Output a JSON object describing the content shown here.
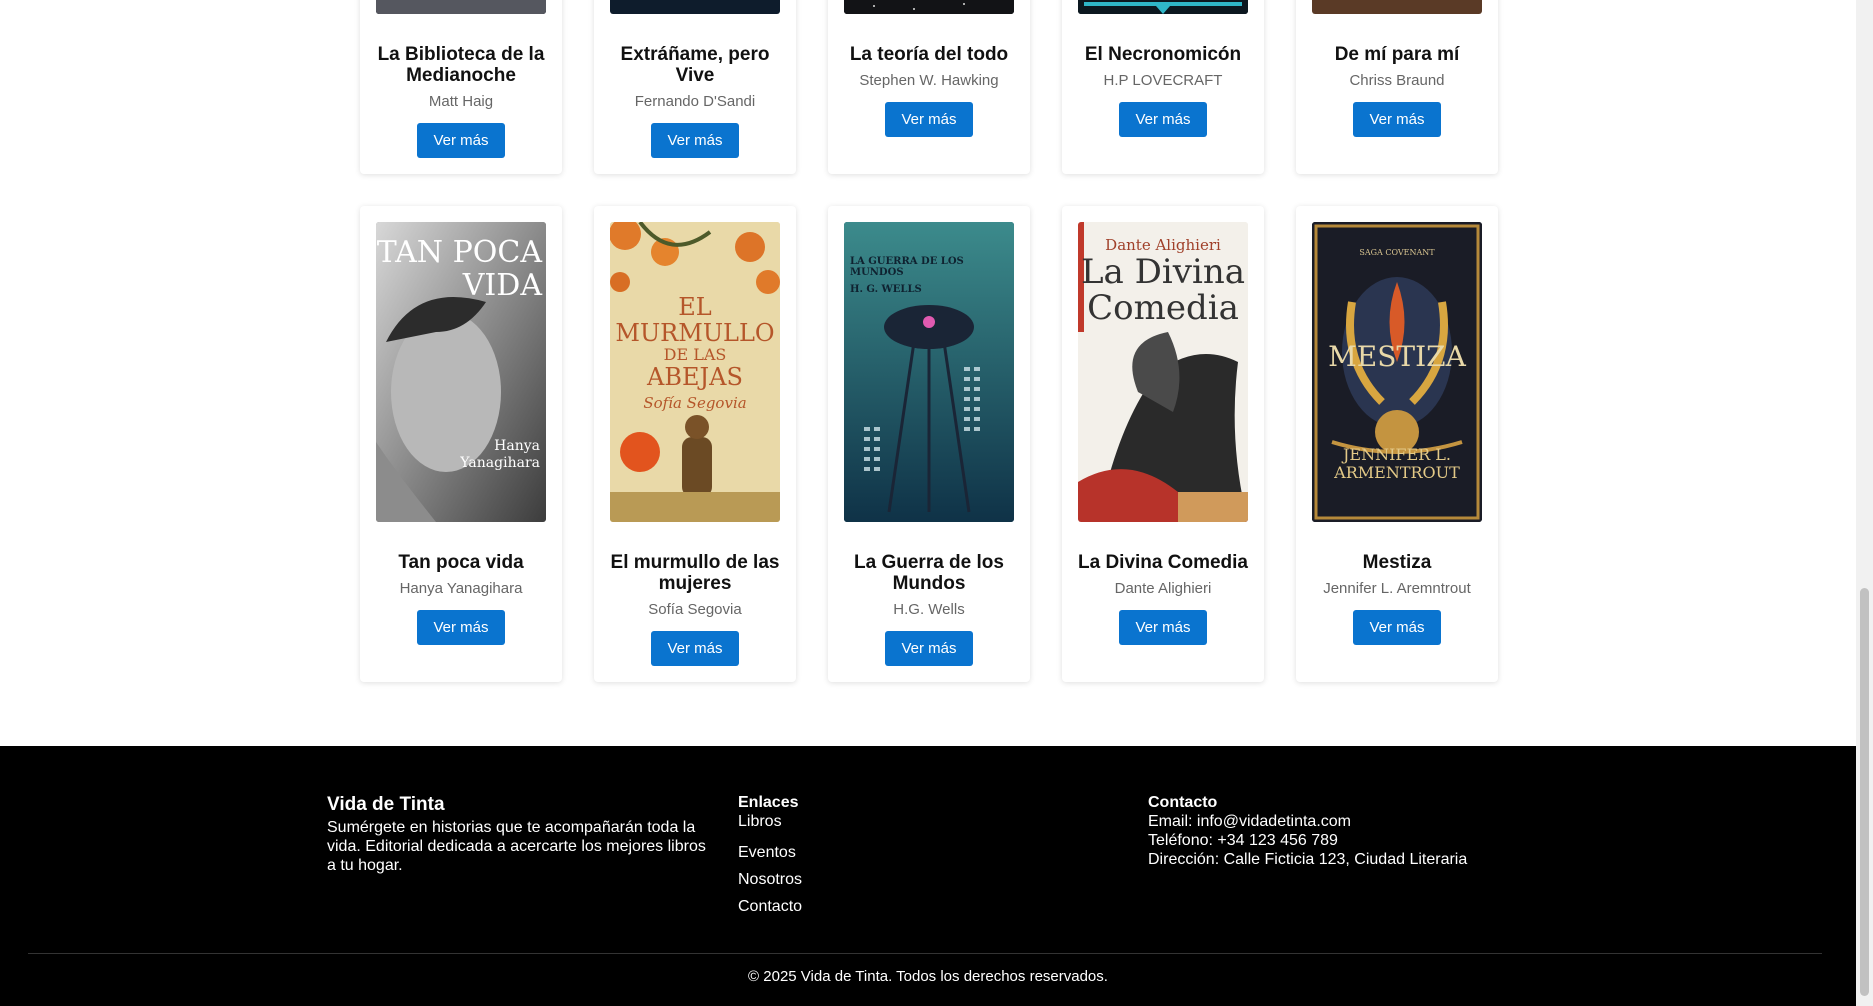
{
  "books_row1": [
    {
      "title": "La Biblioteca de la Medianoche",
      "author": "Matt Haig",
      "button": "Ver más"
    },
    {
      "title": "Extráñame, pero Vive",
      "author": "Fernando D'Sandi",
      "button": "Ver más"
    },
    {
      "title": "La teoría del todo",
      "author": "Stephen W. Hawking",
      "button": "Ver más"
    },
    {
      "title": "El Necronomicón",
      "author": "H.P LOVECRAFT",
      "button": "Ver más"
    },
    {
      "title": "De mí para mí",
      "author": "Chriss Braund",
      "button": "Ver más"
    }
  ],
  "books_row2": [
    {
      "title": "Tan poca vida",
      "author": "Hanya Yanagihara",
      "button": "Ver más",
      "cover_text": [
        "TAN POCA",
        "VIDA",
        "Hanya",
        "Yanagihara"
      ]
    },
    {
      "title": "El murmullo de las mujeres",
      "author": "Sofía Segovia",
      "button": "Ver más",
      "cover_text": [
        "EL",
        "MURMULLO",
        "DE LAS",
        "ABEJAS",
        "Sofía Segovia"
      ]
    },
    {
      "title": "La Guerra de los Mundos",
      "author": "H.G. Wells",
      "button": "Ver más",
      "cover_text": [
        "LA GUERRA DE LOS MUNDOS",
        "H. G. WELLS"
      ]
    },
    {
      "title": "La Divina Comedia",
      "author": "Dante Alighieri",
      "button": "Ver más",
      "cover_text": [
        "Dante Alighieri",
        "La Divina",
        "Comedia"
      ]
    },
    {
      "title": "Mestiza",
      "author": "Jennifer L. Aremntrout",
      "button": "Ver más",
      "cover_text": [
        "SAGA COVENANT",
        "MESTIZA",
        "JENNIFER L.",
        "ARMENTROUT"
      ]
    }
  ],
  "footer": {
    "brand": "Vida de Tinta",
    "description": "Sumérgete en historias que te acompañarán toda la vida. Editorial dedicada a acercarte los mejores libros a tu hogar.",
    "links_title": "Enlaces",
    "links": [
      "Libros",
      "Eventos",
      "Nosotros",
      "Contacto"
    ],
    "contact_title": "Contacto",
    "email": "Email: info@vidadetinta.com",
    "phone": "Teléfono: +34 123 456 789",
    "address": "Dirección: Calle Ficticia 123, Ciudad Literaria",
    "copyright": "© 2025 Vida de Tinta. Todos los derechos reservados."
  }
}
